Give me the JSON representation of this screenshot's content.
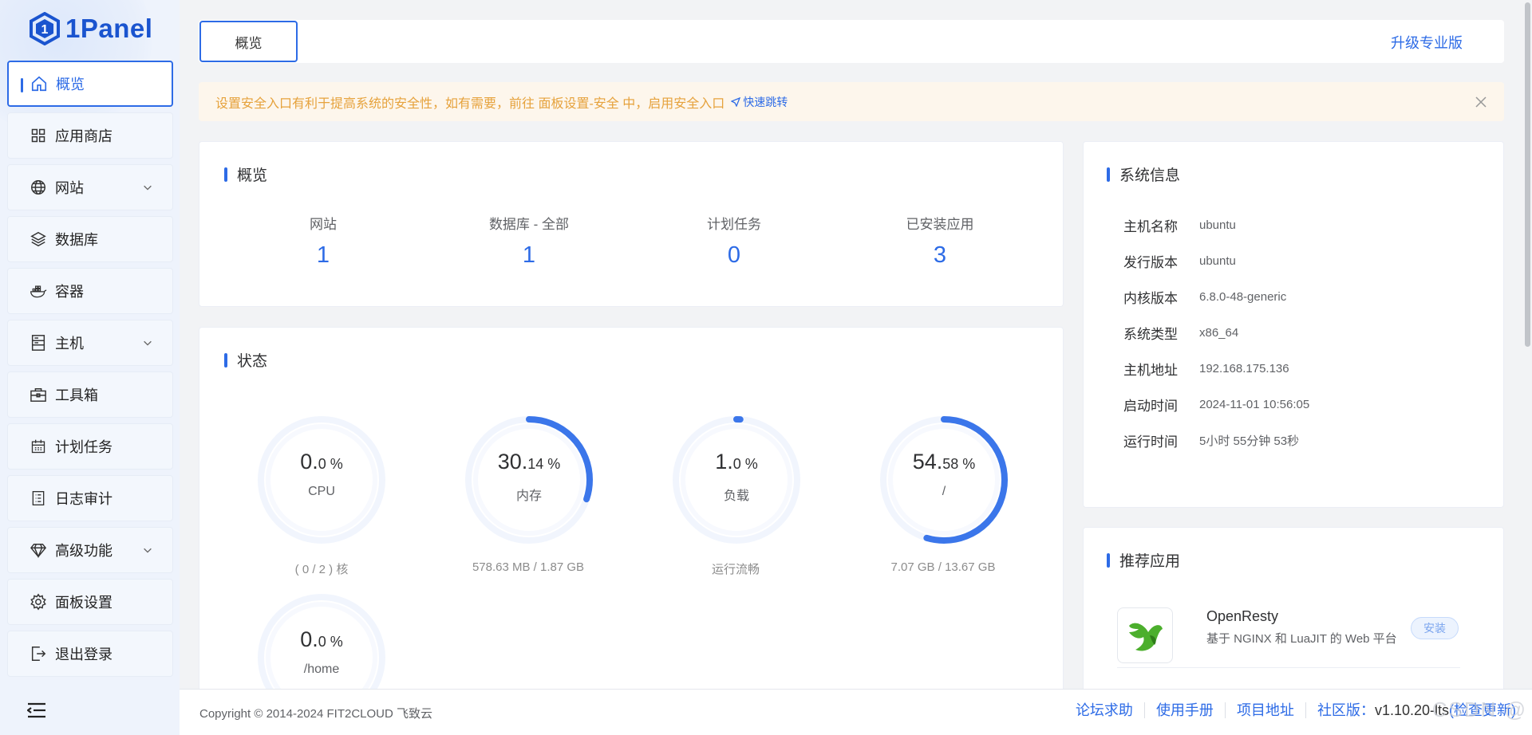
{
  "brand": {
    "logo_text": "1Panel"
  },
  "sidebar": {
    "items": [
      {
        "label": "概览",
        "icon": "home-icon"
      },
      {
        "label": "应用商店",
        "icon": "grid-icon"
      },
      {
        "label": "网站",
        "icon": "globe-icon"
      },
      {
        "label": "数据库",
        "icon": "layers-icon"
      },
      {
        "label": "容器",
        "icon": "docker-icon"
      },
      {
        "label": "主机",
        "icon": "server-icon"
      },
      {
        "label": "工具箱",
        "icon": "toolbox-icon"
      },
      {
        "label": "计划任务",
        "icon": "calendar-icon"
      },
      {
        "label": "日志审计",
        "icon": "log-icon"
      },
      {
        "label": "高级功能",
        "icon": "diamond-icon"
      },
      {
        "label": "面板设置",
        "icon": "gear-icon"
      },
      {
        "label": "退出登录",
        "icon": "logout-icon"
      }
    ]
  },
  "topbar": {
    "tab_label": "概览",
    "upgrade_label": "升级专业版"
  },
  "alert": {
    "text": "设置安全入口有利于提高系统的安全性，如有需要，前往 面板设置-安全 中，启用安全入口",
    "link": "快速跳转"
  },
  "overview": {
    "title": "概览",
    "stats": [
      {
        "label": "网站",
        "value": "1"
      },
      {
        "label": "数据库 - 全部",
        "value": "1"
      },
      {
        "label": "计划任务",
        "value": "0"
      },
      {
        "label": "已安装应用",
        "value": "3"
      }
    ]
  },
  "status": {
    "title": "状态",
    "gauges": [
      {
        "int": "0.",
        "dec": "0 %",
        "label": "CPU",
        "sub": "( 0 / 2 ) 核",
        "percent": 0.0
      },
      {
        "int": "30.",
        "dec": "14 %",
        "label": "内存",
        "sub": "578.63 MB / 1.87 GB",
        "percent": 30.14
      },
      {
        "int": "1.",
        "dec": "0 %",
        "label": "负载",
        "sub": "运行流畅",
        "percent": 1.0
      },
      {
        "int": "54.",
        "dec": "58 %",
        "label": "/",
        "sub": "7.07 GB / 13.67 GB",
        "percent": 54.58
      },
      {
        "int": "0.",
        "dec": "0 %",
        "label": "/home",
        "sub": "",
        "percent": 0.0
      }
    ]
  },
  "system_info": {
    "title": "系统信息",
    "rows": [
      {
        "key": "主机名称",
        "value": "ubuntu"
      },
      {
        "key": "发行版本",
        "value": "ubuntu"
      },
      {
        "key": "内核版本",
        "value": "6.8.0-48-generic"
      },
      {
        "key": "系统类型",
        "value": "x86_64"
      },
      {
        "key": "主机地址",
        "value": "192.168.175.136"
      },
      {
        "key": "启动时间",
        "value": "2024-11-01 10:56:05"
      },
      {
        "key": "运行时间",
        "value": "5小时 55分钟 53秒"
      }
    ]
  },
  "recommend": {
    "title": "推荐应用",
    "apps": [
      {
        "name": "OpenResty",
        "desc": "基于 NGINX 和 LuaJIT 的 Web 平台",
        "button": "安装"
      }
    ]
  },
  "footer": {
    "copyright": "Copyright © 2014-2024 FIT2CLOUD 飞致云",
    "links": [
      "论坛求助",
      "使用手册",
      "项目地址",
      "社区版："
    ],
    "version": "v1.10.20-lts",
    "check_update": "(检查更新)",
    "watermark": "CSDN @"
  },
  "colors": {
    "accent": "#2d6be6",
    "warning": "#e6a23c",
    "sidebar_bg": "#eef3fc"
  }
}
